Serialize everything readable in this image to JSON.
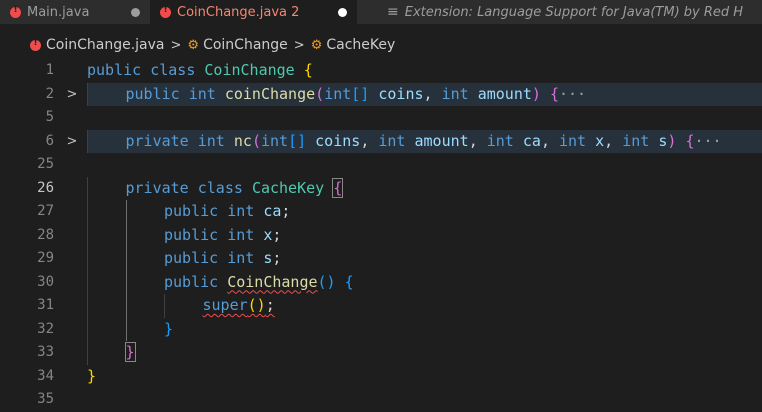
{
  "tabs": [
    {
      "label": "Main.java",
      "icon": "java-error-icon",
      "state": "dirty"
    },
    {
      "label": "CoinChange.java 2",
      "icon": "java-error-icon",
      "state": "active-dirty"
    },
    {
      "label": "Extension: Language Support for Java(TM) by Red H",
      "icon": "preview-icon"
    }
  ],
  "breadcrumb": {
    "file": "CoinChange.java",
    "class": "CoinChange",
    "inner": "CacheKey",
    "separator": ">"
  },
  "colors": {
    "error": "#f14c4c",
    "keyword": "#569cd6",
    "type": "#4ec9b0",
    "function": "#dcdcaa",
    "variable": "#9cdcfe"
  },
  "fold_marker": ">",
  "editor": {
    "lines": [
      {
        "num": "1",
        "indent": 0,
        "tokens": [
          {
            "t": "public",
            "c": "kw"
          },
          {
            "t": " "
          },
          {
            "t": "class",
            "c": "kw"
          },
          {
            "t": " "
          },
          {
            "t": "CoinChange",
            "c": "cls"
          },
          {
            "t": " "
          },
          {
            "t": "{",
            "c": "br1"
          }
        ]
      },
      {
        "num": "2",
        "fold": true,
        "folded": true,
        "indent": 1,
        "tokens": [
          {
            "t": "public",
            "c": "kw"
          },
          {
            "t": " "
          },
          {
            "t": "int",
            "c": "kw"
          },
          {
            "t": " "
          },
          {
            "t": "coinChange",
            "c": "fn"
          },
          {
            "t": "(",
            "c": "br2"
          },
          {
            "t": "int",
            "c": "kw"
          },
          {
            "t": "[]",
            "c": "br3"
          },
          {
            "t": " "
          },
          {
            "t": "coins",
            "c": "var"
          },
          {
            "t": ", ",
            "c": "pun"
          },
          {
            "t": "int",
            "c": "kw"
          },
          {
            "t": " "
          },
          {
            "t": "amount",
            "c": "var"
          },
          {
            "t": ")",
            "c": "br2"
          },
          {
            "t": " "
          },
          {
            "t": "{",
            "c": "br2"
          },
          {
            "t": "···",
            "c": "ellipsis"
          }
        ]
      },
      {
        "num": "5",
        "indent": 0,
        "tokens": []
      },
      {
        "num": "6",
        "fold": true,
        "folded": true,
        "indent": 1,
        "tokens": [
          {
            "t": "private",
            "c": "kw"
          },
          {
            "t": " "
          },
          {
            "t": "int",
            "c": "kw"
          },
          {
            "t": " "
          },
          {
            "t": "nc",
            "c": "fn"
          },
          {
            "t": "(",
            "c": "br2"
          },
          {
            "t": "int",
            "c": "kw"
          },
          {
            "t": "[]",
            "c": "br3"
          },
          {
            "t": " "
          },
          {
            "t": "coins",
            "c": "var"
          },
          {
            "t": ", ",
            "c": "pun"
          },
          {
            "t": "int",
            "c": "kw"
          },
          {
            "t": " "
          },
          {
            "t": "amount",
            "c": "var"
          },
          {
            "t": ", ",
            "c": "pun"
          },
          {
            "t": "int",
            "c": "kw"
          },
          {
            "t": " "
          },
          {
            "t": "ca",
            "c": "var"
          },
          {
            "t": ", ",
            "c": "pun"
          },
          {
            "t": "int",
            "c": "kw"
          },
          {
            "t": " "
          },
          {
            "t": "x",
            "c": "var"
          },
          {
            "t": ", ",
            "c": "pun"
          },
          {
            "t": "int",
            "c": "kw"
          },
          {
            "t": " "
          },
          {
            "t": "s",
            "c": "var"
          },
          {
            "t": ")",
            "c": "br2"
          },
          {
            "t": " "
          },
          {
            "t": "{",
            "c": "br2"
          },
          {
            "t": "···",
            "c": "ellipsis"
          }
        ]
      },
      {
        "num": "25",
        "indent": 0,
        "tokens": []
      },
      {
        "num": "26",
        "current": true,
        "indent": 1,
        "tokens": [
          {
            "t": "private",
            "c": "kw"
          },
          {
            "t": " "
          },
          {
            "t": "class",
            "c": "kw"
          },
          {
            "t": " "
          },
          {
            "t": "CacheKey",
            "c": "cls"
          },
          {
            "t": " "
          },
          {
            "t": "{",
            "c": "br2 match"
          }
        ]
      },
      {
        "num": "27",
        "indent": 2,
        "tokens": [
          {
            "t": "public",
            "c": "kw"
          },
          {
            "t": " "
          },
          {
            "t": "int",
            "c": "kw"
          },
          {
            "t": " "
          },
          {
            "t": "ca",
            "c": "var"
          },
          {
            "t": ";",
            "c": "pun"
          }
        ]
      },
      {
        "num": "28",
        "indent": 2,
        "tokens": [
          {
            "t": "public",
            "c": "kw"
          },
          {
            "t": " "
          },
          {
            "t": "int",
            "c": "kw"
          },
          {
            "t": " "
          },
          {
            "t": "x",
            "c": "var"
          },
          {
            "t": ";",
            "c": "pun"
          }
        ]
      },
      {
        "num": "29",
        "indent": 2,
        "tokens": [
          {
            "t": "public",
            "c": "kw"
          },
          {
            "t": " "
          },
          {
            "t": "int",
            "c": "kw"
          },
          {
            "t": " "
          },
          {
            "t": "s",
            "c": "var"
          },
          {
            "t": ";",
            "c": "pun"
          }
        ]
      },
      {
        "num": "30",
        "indent": 2,
        "tokens": [
          {
            "t": "public",
            "c": "kw"
          },
          {
            "t": " "
          },
          {
            "t": "CoinChange",
            "c": "fn squig"
          },
          {
            "t": "()",
            "c": "br3"
          },
          {
            "t": " "
          },
          {
            "t": "{",
            "c": "br3"
          }
        ]
      },
      {
        "num": "31",
        "indent": 3,
        "tokens": [
          {
            "t": "super",
            "c": "kw squig"
          },
          {
            "t": "()",
            "c": "br1 squig"
          },
          {
            "t": ";",
            "c": "pun squig"
          }
        ]
      },
      {
        "num": "32",
        "indent": 2,
        "tokens": [
          {
            "t": "}",
            "c": "br3"
          }
        ]
      },
      {
        "num": "33",
        "indent": 1,
        "tokens": [
          {
            "t": "}",
            "c": "br2 match"
          }
        ]
      },
      {
        "num": "34",
        "indent": 0,
        "tokens": [
          {
            "t": "}",
            "c": "br1"
          }
        ]
      },
      {
        "num": "35",
        "indent": 0,
        "tokens": []
      }
    ]
  }
}
